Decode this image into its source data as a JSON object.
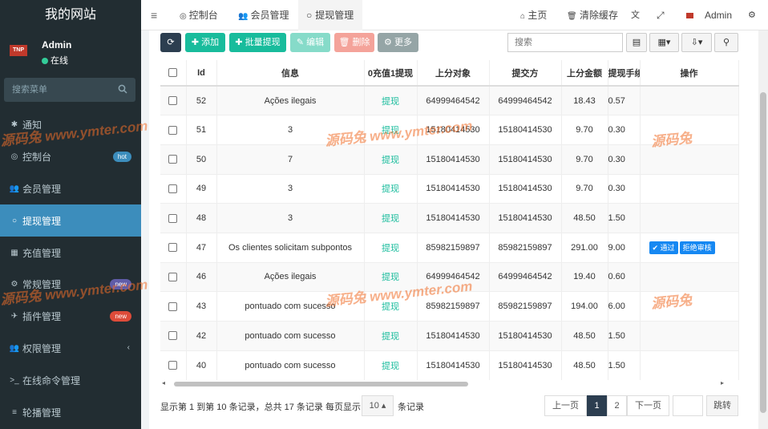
{
  "brand": "我的网站",
  "user": {
    "name": "Admin",
    "status": "在线",
    "avatar_text": "TNP"
  },
  "search": {
    "placeholder": "搜索菜单"
  },
  "menu": [
    {
      "label": "通知",
      "icon": "✱"
    },
    {
      "label": "控制台",
      "icon": "◎",
      "badge": "hot",
      "badge_color": "#3c8dbc"
    },
    {
      "label": "会员管理",
      "icon": "👥"
    },
    {
      "label": "提现管理",
      "icon": "○",
      "active": true
    },
    {
      "label": "充值管理",
      "icon": "▦"
    },
    {
      "label": "常规管理",
      "icon": "⚙",
      "badge": "new",
      "badge_color": "#605ca8"
    },
    {
      "label": "插件管理",
      "icon": "✈",
      "badge": "new",
      "badge_color": "#dd4b39"
    },
    {
      "label": "权限管理",
      "icon": "👥",
      "caret": "‹"
    },
    {
      "label": "在线命令管理",
      "icon": ">_"
    },
    {
      "label": "轮播管理",
      "icon": "≡"
    }
  ],
  "topbar": {
    "tabs": [
      "控制台",
      "会员管理",
      "提现管理"
    ],
    "home": "主页",
    "clear_cache": "清除缓存",
    "admin": "Admin"
  },
  "toolbar": {
    "add": "添加",
    "batch": "批量提现",
    "edit": "编辑",
    "delete": "删除",
    "more": "更多",
    "search_placeholder": "搜索"
  },
  "columns": [
    "Id",
    "信息",
    "0充值1提现",
    "上分对象",
    "提交方",
    "上分金额",
    "提现手续",
    "操作"
  ],
  "rows": [
    {
      "id": "52",
      "info": "Ações ilegais",
      "type": "提现",
      "target": "64999464542",
      "submitter": "64999464542",
      "amount": "18.43",
      "fee": "0.57",
      "actions": false
    },
    {
      "id": "51",
      "info": "3",
      "type": "提现",
      "target": "15180414530",
      "submitter": "15180414530",
      "amount": "9.70",
      "fee": "0.30",
      "actions": false
    },
    {
      "id": "50",
      "info": "7",
      "type": "提现",
      "target": "15180414530",
      "submitter": "15180414530",
      "amount": "9.70",
      "fee": "0.30",
      "actions": false
    },
    {
      "id": "49",
      "info": "3",
      "type": "提现",
      "target": "15180414530",
      "submitter": "15180414530",
      "amount": "9.70",
      "fee": "0.30",
      "actions": false
    },
    {
      "id": "48",
      "info": "3",
      "type": "提现",
      "target": "15180414530",
      "submitter": "15180414530",
      "amount": "48.50",
      "fee": "1.50",
      "actions": false
    },
    {
      "id": "47",
      "info": "Os clientes solicitam subpontos",
      "type": "提现",
      "target": "85982159897",
      "submitter": "85982159897",
      "amount": "291.00",
      "fee": "9.00",
      "actions": true
    },
    {
      "id": "46",
      "info": "Ações ilegais",
      "type": "提现",
      "target": "64999464542",
      "submitter": "64999464542",
      "amount": "19.40",
      "fee": "0.60",
      "actions": false
    },
    {
      "id": "43",
      "info": "pontuado com sucesso",
      "type": "提现",
      "target": "85982159897",
      "submitter": "85982159897",
      "amount": "194.00",
      "fee": "6.00",
      "actions": false
    },
    {
      "id": "42",
      "info": "pontuado com sucesso",
      "type": "提现",
      "target": "15180414530",
      "submitter": "15180414530",
      "amount": "48.50",
      "fee": "1.50",
      "actions": false
    },
    {
      "id": "40",
      "info": "pontuado com sucesso",
      "type": "提现",
      "target": "15180414530",
      "submitter": "15180414530",
      "amount": "48.50",
      "fee": "1.50",
      "actions": false
    }
  ],
  "row_actions": {
    "pass": "通过",
    "reject": "拒绝审核"
  },
  "pager": {
    "summary_a": "显示第 1 到第 10 条记录，总共 17 条记录 每页显示",
    "page_size": "10",
    "summary_b": "条记录",
    "prev": "上一页",
    "pages": [
      "1",
      "2"
    ],
    "next": "下一页",
    "jump": "跳转"
  },
  "watermark": {
    "text1": "www.ymter.com",
    "text2": "源码兔"
  }
}
